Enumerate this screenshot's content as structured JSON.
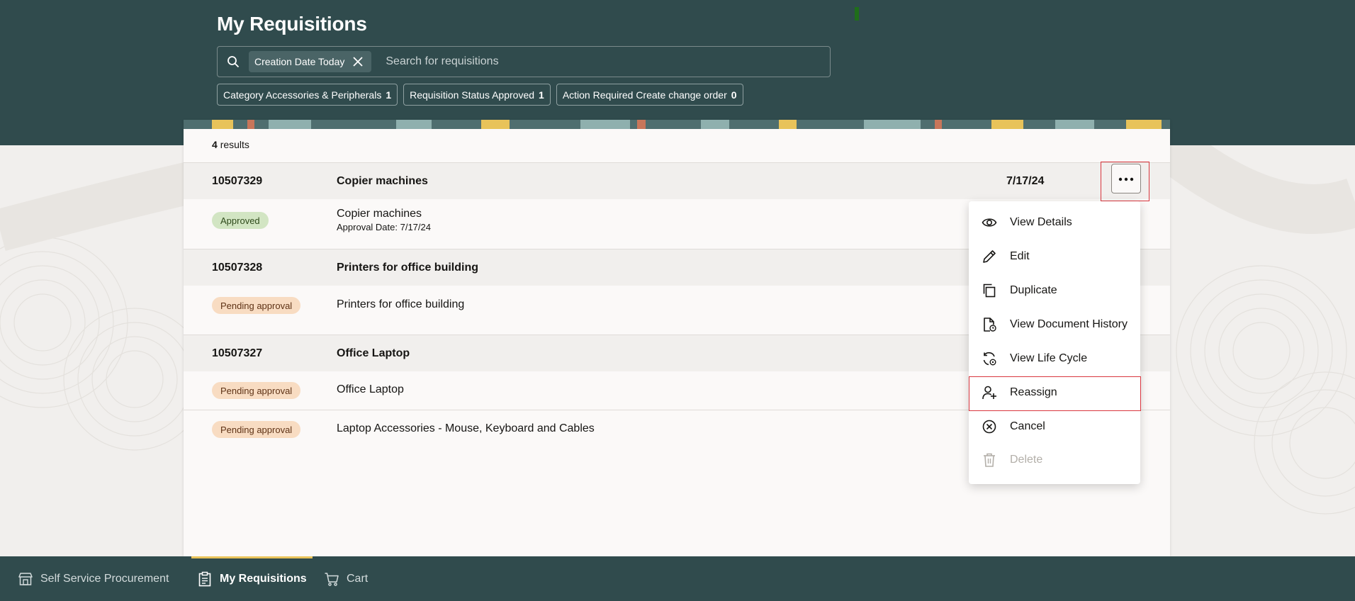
{
  "header": {
    "title": "My Requisitions"
  },
  "search": {
    "chip_label": "Creation Date Today",
    "placeholder": "Search for requisitions"
  },
  "filters": [
    {
      "label": "Category Accessories & Peripherals",
      "count": "1"
    },
    {
      "label": "Requisition Status Approved",
      "count": "1"
    },
    {
      "label": "Action Required Create change order",
      "count": "0"
    }
  ],
  "results": {
    "count": "4",
    "label": "results"
  },
  "requisitions": [
    {
      "number": "10507329",
      "name": "Copier machines",
      "date": "7/17/24",
      "lines": [
        {
          "status": "Approved",
          "description": "Copier machines",
          "detail": "Approval Date: 7/17/24"
        }
      ]
    },
    {
      "number": "10507328",
      "name": "Printers for office building",
      "lines": [
        {
          "status": "Pending approval",
          "description": "Printers for office building"
        }
      ]
    },
    {
      "number": "10507327",
      "name": "Office Laptop",
      "lines": [
        {
          "status": "Pending approval",
          "description": "Office Laptop"
        },
        {
          "status": "Pending approval",
          "description": "Laptop Accessories - Mouse, Keyboard and Cables"
        }
      ]
    }
  ],
  "actions_menu": {
    "items": [
      {
        "label": "View Details",
        "icon": "eye-icon"
      },
      {
        "label": "Edit",
        "icon": "pencil-icon"
      },
      {
        "label": "Duplicate",
        "icon": "copy-icon"
      },
      {
        "label": "View Document History",
        "icon": "document-history-icon"
      },
      {
        "label": "View Life Cycle",
        "icon": "life-cycle-icon"
      },
      {
        "label": "Reassign",
        "icon": "person-add-icon"
      },
      {
        "label": "Cancel",
        "icon": "cancel-circle-icon"
      },
      {
        "label": "Delete",
        "icon": "trash-icon",
        "disabled": true
      }
    ]
  },
  "bottom_nav": {
    "items": [
      {
        "label": "Self Service Procurement",
        "icon": "store-icon"
      },
      {
        "label": "My Requisitions",
        "icon": "clipboard-icon",
        "active": true
      },
      {
        "label": "Cart",
        "icon": "cart-icon"
      }
    ]
  },
  "colors": {
    "header_bg": "#304b4d",
    "approved_badge": "#d2e5c3",
    "pending_badge": "#f8dcc2",
    "highlight": "#d9363e",
    "active_nav_accent": "#e8c35a"
  }
}
